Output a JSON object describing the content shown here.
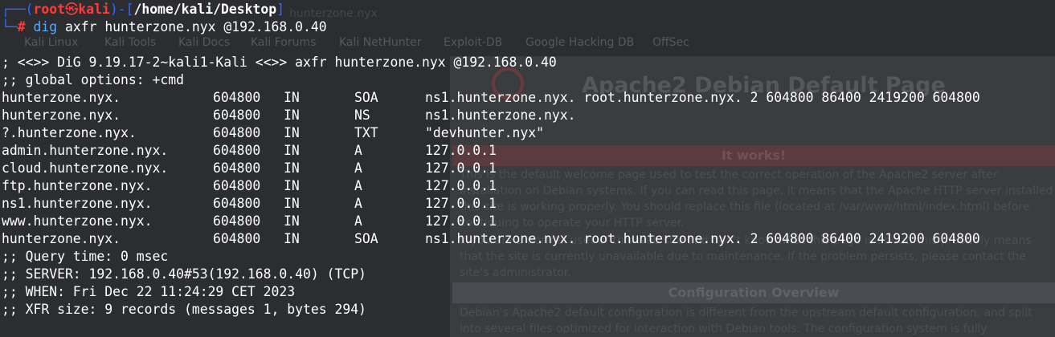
{
  "background_browser": {
    "ghost_title": "hunterzone.nyx",
    "bookmarks": [
      "Kali Linux",
      "Kali Tools",
      "Kali Docs",
      "Kali Forums",
      "Kali NetHunter",
      "Exploit-DB",
      "Google Hacking DB",
      "OffSec"
    ],
    "page_heading": "Apache2 Debian Default Page",
    "banner_label": "It works!",
    "section_label": "Configuration Overview",
    "para1_lines": [
      "This is the default welcome page used to test the correct operation of the Apache2 server after",
      "installation on Debian systems. If you can read this page, it means that the Apache HTTP server installed at",
      "this site is working properly. You should replace this file (located at /var/www/html/index.html) before",
      "continuing to operate your HTTP server."
    ],
    "para2_lines": [
      "If you are a normal user of this web site and don't know what this page is about, this probably means",
      "that the site is currently unavailable due to maintenance. If the problem persists, please contact the",
      "site's administrator."
    ],
    "para3_lines": [
      "Debian's Apache2 default configuration is different from the upstream default configuration, and split",
      "into several files optimized for interaction with Debian tools. The configuration system is fully"
    ]
  },
  "prompt": {
    "frame_open": "┌──(",
    "user": "root",
    "skull": "㉿",
    "host": "kali",
    "frame_mid": ")-[",
    "path": "/home/kali/Desktop",
    "frame_close": "]",
    "frame_bottom": "└─",
    "symbol": "#",
    "command": "dig",
    "arguments": " axfr hunterzone.nyx @192.168.0.40"
  },
  "output": {
    "header_lines": [
      "; <<>> DiG 9.19.17-2~kali1-Kali <<>> axfr hunterzone.nyx @192.168.0.40",
      ";; global options: +cmd"
    ],
    "records": [
      {
        "name": "hunterzone.nyx.",
        "ttl": "604800",
        "class": "IN",
        "type": "SOA",
        "data": "ns1.hunterzone.nyx. root.hunterzone.nyx. 2 604800 86400 2419200 604800"
      },
      {
        "name": "hunterzone.nyx.",
        "ttl": "604800",
        "class": "IN",
        "type": "NS",
        "data": "ns1.hunterzone.nyx."
      },
      {
        "name": "?.hunterzone.nyx.",
        "ttl": "604800",
        "class": "IN",
        "type": "TXT",
        "data": "\"devhunter.nyx\""
      },
      {
        "name": "admin.hunterzone.nyx.",
        "ttl": "604800",
        "class": "IN",
        "type": "A",
        "data": "127.0.0.1"
      },
      {
        "name": "cloud.hunterzone.nyx.",
        "ttl": "604800",
        "class": "IN",
        "type": "A",
        "data": "127.0.0.1"
      },
      {
        "name": "ftp.hunterzone.nyx.",
        "ttl": "604800",
        "class": "IN",
        "type": "A",
        "data": "127.0.0.1"
      },
      {
        "name": "ns1.hunterzone.nyx.",
        "ttl": "604800",
        "class": "IN",
        "type": "A",
        "data": "127.0.0.1"
      },
      {
        "name": "www.hunterzone.nyx.",
        "ttl": "604800",
        "class": "IN",
        "type": "A",
        "data": "127.0.0.1"
      },
      {
        "name": "hunterzone.nyx.",
        "ttl": "604800",
        "class": "IN",
        "type": "SOA",
        "data": "ns1.hunterzone.nyx. root.hunterzone.nyx. 2 604800 86400 2419200 604800"
      }
    ],
    "footer_lines": [
      ";; Query time: 0 msec",
      ";; SERVER: 192.168.0.40#53(192.168.0.40) (TCP)",
      ";; WHEN: Fri Dec 22 11:24:29 CET 2023",
      ";; XFR size: 9 records (messages 1, bytes 294)"
    ]
  }
}
